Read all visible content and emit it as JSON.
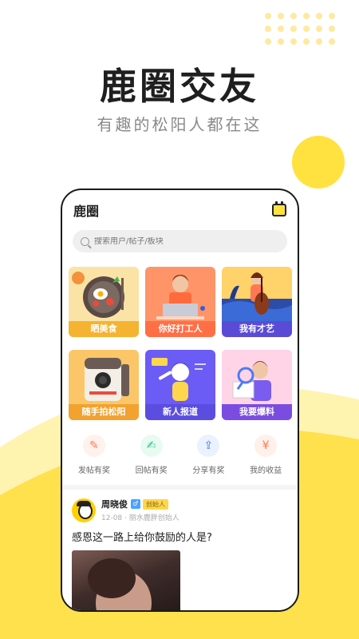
{
  "hero": {
    "title": "鹿圈交友",
    "subtitle": "有趣的松阳人都在这"
  },
  "app": {
    "title": "鹿圈",
    "search_placeholder": "搜索用户/帖子/板块"
  },
  "cards": [
    {
      "label": "晒美食",
      "color": "#f8b94a",
      "icon": "food-plate-illustration"
    },
    {
      "label": "你好打工人",
      "color": "#ff7a52",
      "icon": "office-worker-illustration"
    },
    {
      "label": "我有才艺",
      "color": "#f5a623",
      "icon": "cello-player-illustration"
    },
    {
      "label": "随手拍松阳",
      "color": "#f6a33b",
      "icon": "camera-illustration"
    },
    {
      "label": "新人报道",
      "color": "#6a5cf5",
      "icon": "newcomer-illustration"
    },
    {
      "label": "我要爆料",
      "color": "#8f5cf0",
      "icon": "magnifier-illustration"
    }
  ],
  "actions": [
    {
      "label": "发帖有奖",
      "icon": "edit-icon",
      "bg": "#fff1ec",
      "fg": "#ff7a52"
    },
    {
      "label": "回帖有奖",
      "icon": "reply-icon",
      "bg": "#e8fbf3",
      "fg": "#2cc58c"
    },
    {
      "label": "分享有奖",
      "icon": "share-icon",
      "bg": "#eaf1ff",
      "fg": "#4a7bff"
    },
    {
      "label": "我的收益",
      "icon": "money-bag-icon",
      "bg": "#fff0ea",
      "fg": "#ff7a52"
    }
  ],
  "post": {
    "username": "周晓俊",
    "gender": "♂",
    "role": "创始人",
    "meta": "12-08 · 丽水鹿胖创始人",
    "text": "感恩这一路上给你鼓励的人是?"
  },
  "colors": {
    "accent_yellow": "#ffe23f",
    "wave_yellow": "#ffe14d"
  }
}
